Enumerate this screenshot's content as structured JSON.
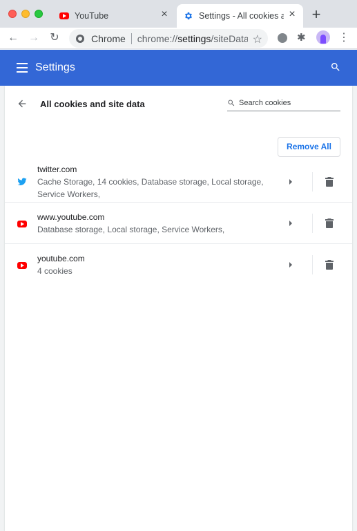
{
  "colors": {
    "accent": "#3367d6",
    "link_blue": "#1a73e8",
    "twitter_blue": "#1da1f2",
    "youtube_red": "#ff0000"
  },
  "tabs": [
    {
      "title": "YouTube",
      "icon": "youtube-icon",
      "active": false
    },
    {
      "title": "Settings - All cookies and site data",
      "icon": "settings-gear-icon",
      "active": true
    }
  ],
  "toolbar": {
    "omnibox_label": "Chrome",
    "url_scheme": "chrome://",
    "url_host": "settings",
    "url_path": "/siteData"
  },
  "header": {
    "title": "Settings"
  },
  "page": {
    "title": "All cookies and site data",
    "search_placeholder": "Search cookies",
    "remove_all_label": "Remove All"
  },
  "sites": [
    {
      "name": "twitter.com",
      "detail": "Cache Storage, 14 cookies, Database storage, Local storage, Service Workers,",
      "icon": "twitter-icon"
    },
    {
      "name": "www.youtube.com",
      "detail": "Database storage, Local storage, Service Workers,",
      "icon": "youtube-icon"
    },
    {
      "name": "youtube.com",
      "detail": "4 cookies",
      "icon": "youtube-icon"
    }
  ]
}
